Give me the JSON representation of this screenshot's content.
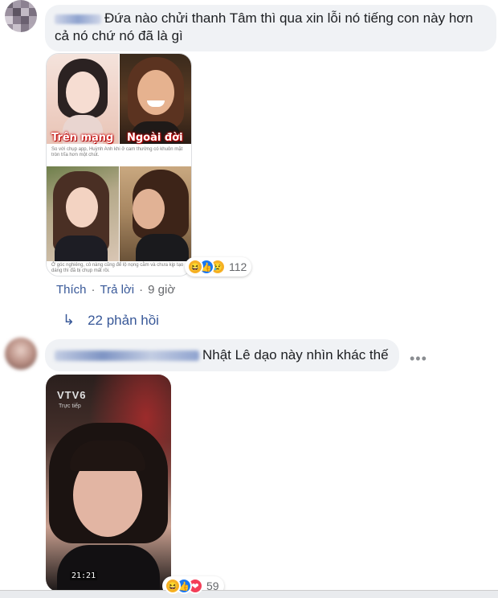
{
  "comments": [
    {
      "text": "Đứa nào chửi thanh Tâm thì qua xin lỗi nó tiếng con này hơn cả nó chứ nó đã là gì",
      "collage": {
        "label_online": "Trên mạng",
        "label_real": "Ngoài đời",
        "caption_1": "So với chụp app, Huỳnh Anh khi ở cam thường có khuôn mặt tròn trĩa hơn một chút.",
        "caption_2": "Ở góc nghiêng, cô nàng cũng để lộ nọng cằm và chưa kịp tạo dáng thì đã bị chụp mất rồi."
      },
      "reaction_count": "112",
      "actions": {
        "like": "Thích",
        "reply": "Trả lời",
        "time": "9 giờ"
      },
      "replies_label": "22 phản hồi"
    },
    {
      "text": "Nhật Lê dạo này nhìn khác thế",
      "image": {
        "channel": "VTV6",
        "live": "Trực tiếp",
        "timestamp": "21:21"
      },
      "reaction_count": "59",
      "more": "•••"
    }
  ],
  "colors": {
    "link": "#385898",
    "bubble": "#f0f2f5",
    "muted": "#65676b"
  },
  "icons": [
    "haha-icon",
    "like-icon",
    "sad-icon",
    "love-icon",
    "reply-arrow-icon",
    "more-icon"
  ]
}
